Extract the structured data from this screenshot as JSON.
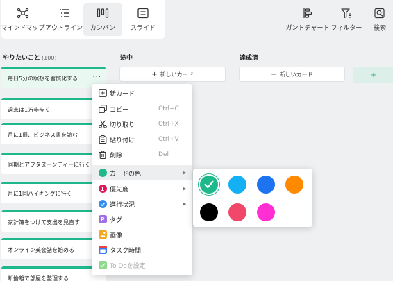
{
  "toolbar": {
    "views": [
      {
        "label": "マインドマップ",
        "icon": "mindmap-icon"
      },
      {
        "label": "アウトライン",
        "icon": "outline-icon"
      },
      {
        "label": "カンバン",
        "icon": "kanban-icon",
        "active": true
      },
      {
        "label": "スライド",
        "icon": "slide-icon"
      }
    ],
    "right": [
      {
        "label": "ガントチャート",
        "icon": "gantt-icon"
      },
      {
        "label": "フィルター",
        "icon": "filter-icon"
      },
      {
        "label": "検索",
        "icon": "search-icon"
      }
    ]
  },
  "columns": [
    {
      "title": "やりたいこと",
      "count": "(100)"
    },
    {
      "title": "途中",
      "new_card": "新しいカード"
    },
    {
      "title": "達成済",
      "new_card": "新しいカード"
    }
  ],
  "ghost_column": {
    "label": "+"
  },
  "cards": [
    {
      "text": "毎日5分の瞑想を習慣化する",
      "more": "···"
    },
    {
      "text": "週末は1万歩歩く"
    },
    {
      "text": "月に1冊、ビジネス書を読む"
    },
    {
      "text": "同期とアフタヌーンティーに行く"
    },
    {
      "text": "月に1回ハイキングに行く"
    },
    {
      "text": "家計簿をつけて支出を見直す"
    },
    {
      "text": "オンライン英会話を始める"
    },
    {
      "text": "断捨離で部屋を整理する"
    }
  ],
  "context_menu": {
    "items": [
      {
        "label": "新カード",
        "icon": "new-card-icon"
      },
      {
        "label": "コピー",
        "shortcut": "Ctrl+C",
        "icon": "copy-icon"
      },
      {
        "label": "切り取り",
        "shortcut": "Ctrl+X",
        "icon": "cut-icon"
      },
      {
        "label": "貼り付け",
        "shortcut": "Ctrl+V",
        "icon": "paste-icon"
      },
      {
        "label": "削除",
        "shortcut": "Del",
        "icon": "delete-icon"
      },
      {
        "label": "カードの色",
        "submenu": "▶",
        "icon": "card-color-icon"
      },
      {
        "label": "優先度",
        "submenu": "▶",
        "icon": "priority-icon",
        "badge": "1"
      },
      {
        "label": "進行状況",
        "submenu": "▶",
        "icon": "progress-icon"
      },
      {
        "label": "タグ",
        "icon": "tag-icon",
        "badge": "P"
      },
      {
        "label": "画像",
        "icon": "image-icon"
      },
      {
        "label": "タスク時間",
        "icon": "task-time-icon"
      },
      {
        "label": "To Doを設定",
        "icon": "todo-icon",
        "disabled": true
      }
    ]
  },
  "color_palette": {
    "selected": "#1fb78c",
    "colors": [
      "#1fb78c",
      "#13b0f5",
      "#1e74f0",
      "#ff8a00",
      "#000000",
      "#f0476a",
      "#ff2fd3"
    ]
  },
  "colors": {
    "accent": "#1fb78c",
    "priority": "#e0195e",
    "progress": "#2f8ff7",
    "tag": "#a070e8",
    "image": "#f5a623",
    "task_time": "#3c7cf0",
    "todo": "#8ed98e"
  }
}
